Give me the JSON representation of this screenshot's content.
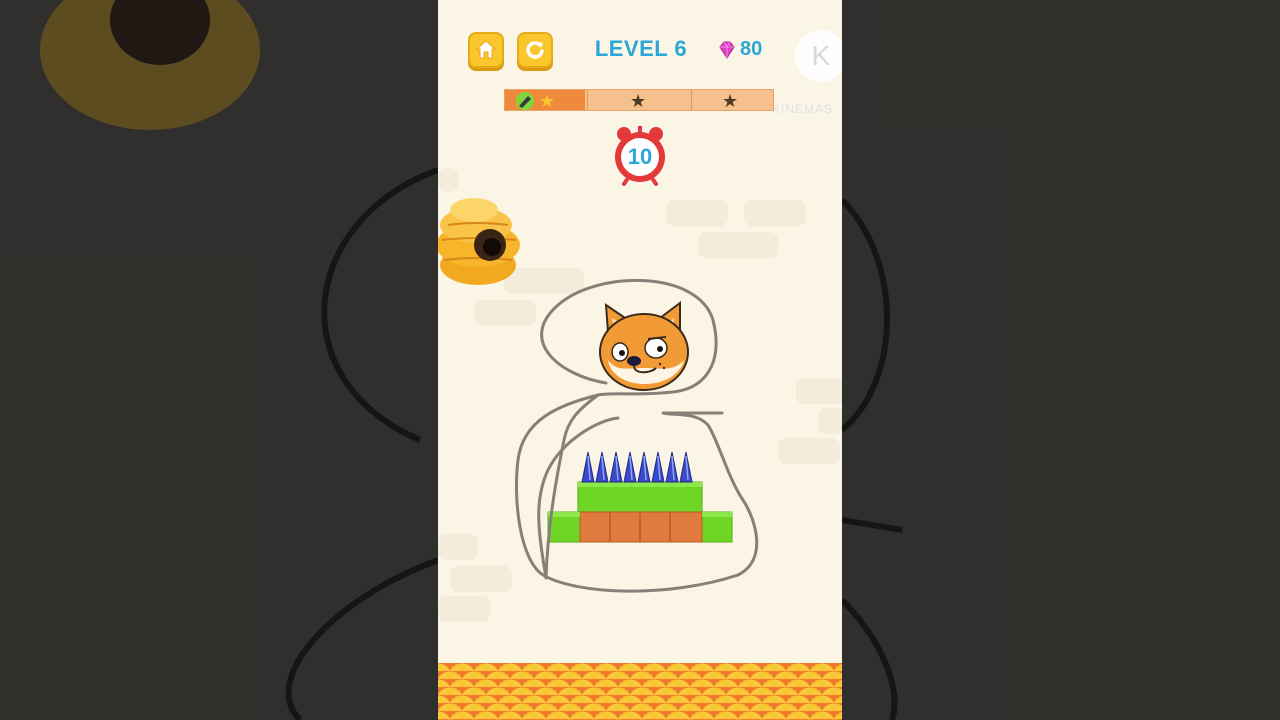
{
  "header": {
    "level_label": "LEVEL 6",
    "gems": "80",
    "home_icon": "home-icon",
    "restart_icon": "restart-icon"
  },
  "progress": {
    "fill_fraction": 0.3,
    "stars_total": 3,
    "stars_earned": 1
  },
  "timer": {
    "seconds": "10"
  },
  "watermark": {
    "logo_letter": "K",
    "text": "KINEMAS"
  },
  "colors": {
    "accent_blue": "#2aa6d8",
    "button_yellow": "#f9c62c",
    "gem_pink": "#e040c8",
    "timer_red": "#e23a3a",
    "lava_orange": "#f07a2a",
    "grass_green": "#6fd626",
    "dirt_brown": "#e07a3e"
  }
}
